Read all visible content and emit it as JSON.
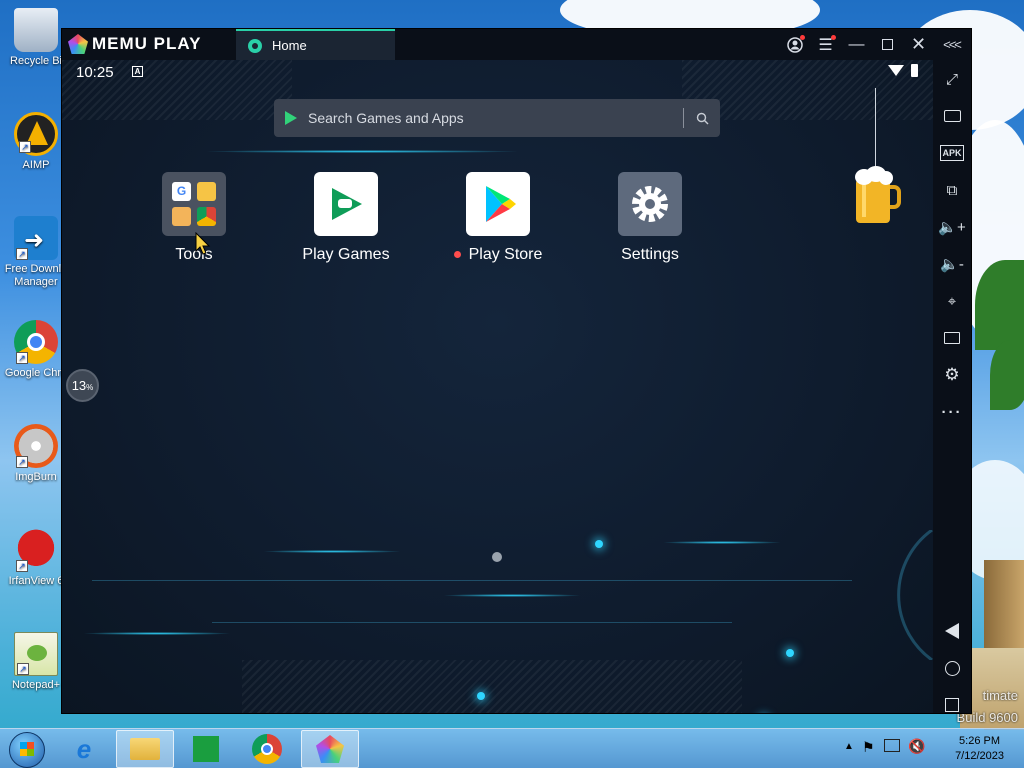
{
  "desktop": {
    "icons": [
      {
        "label": "Recycle Bi"
      },
      {
        "label": "AIMP"
      },
      {
        "label": "Free Downlo Manager"
      },
      {
        "label": "Google Chro"
      },
      {
        "label": "ImgBurn"
      },
      {
        "label": "IrfanView 6"
      },
      {
        "label": "Notepad+"
      }
    ],
    "watermark_line1": "timate",
    "watermark_line2": "Build 9600"
  },
  "emulator": {
    "brand": "MEMU PLAY",
    "tab_label": "Home",
    "status_time": "10:25",
    "search_placeholder": "Search Games and Apps",
    "apps": [
      {
        "label": "Tools"
      },
      {
        "label": "Play Games"
      },
      {
        "label": "Play Store"
      },
      {
        "label": "Settings"
      }
    ],
    "progress_value": "13",
    "progress_unit": "%",
    "accent": "#2ad0a8"
  },
  "taskbar": {
    "time": "5:26 PM",
    "date": "7/12/2023"
  }
}
